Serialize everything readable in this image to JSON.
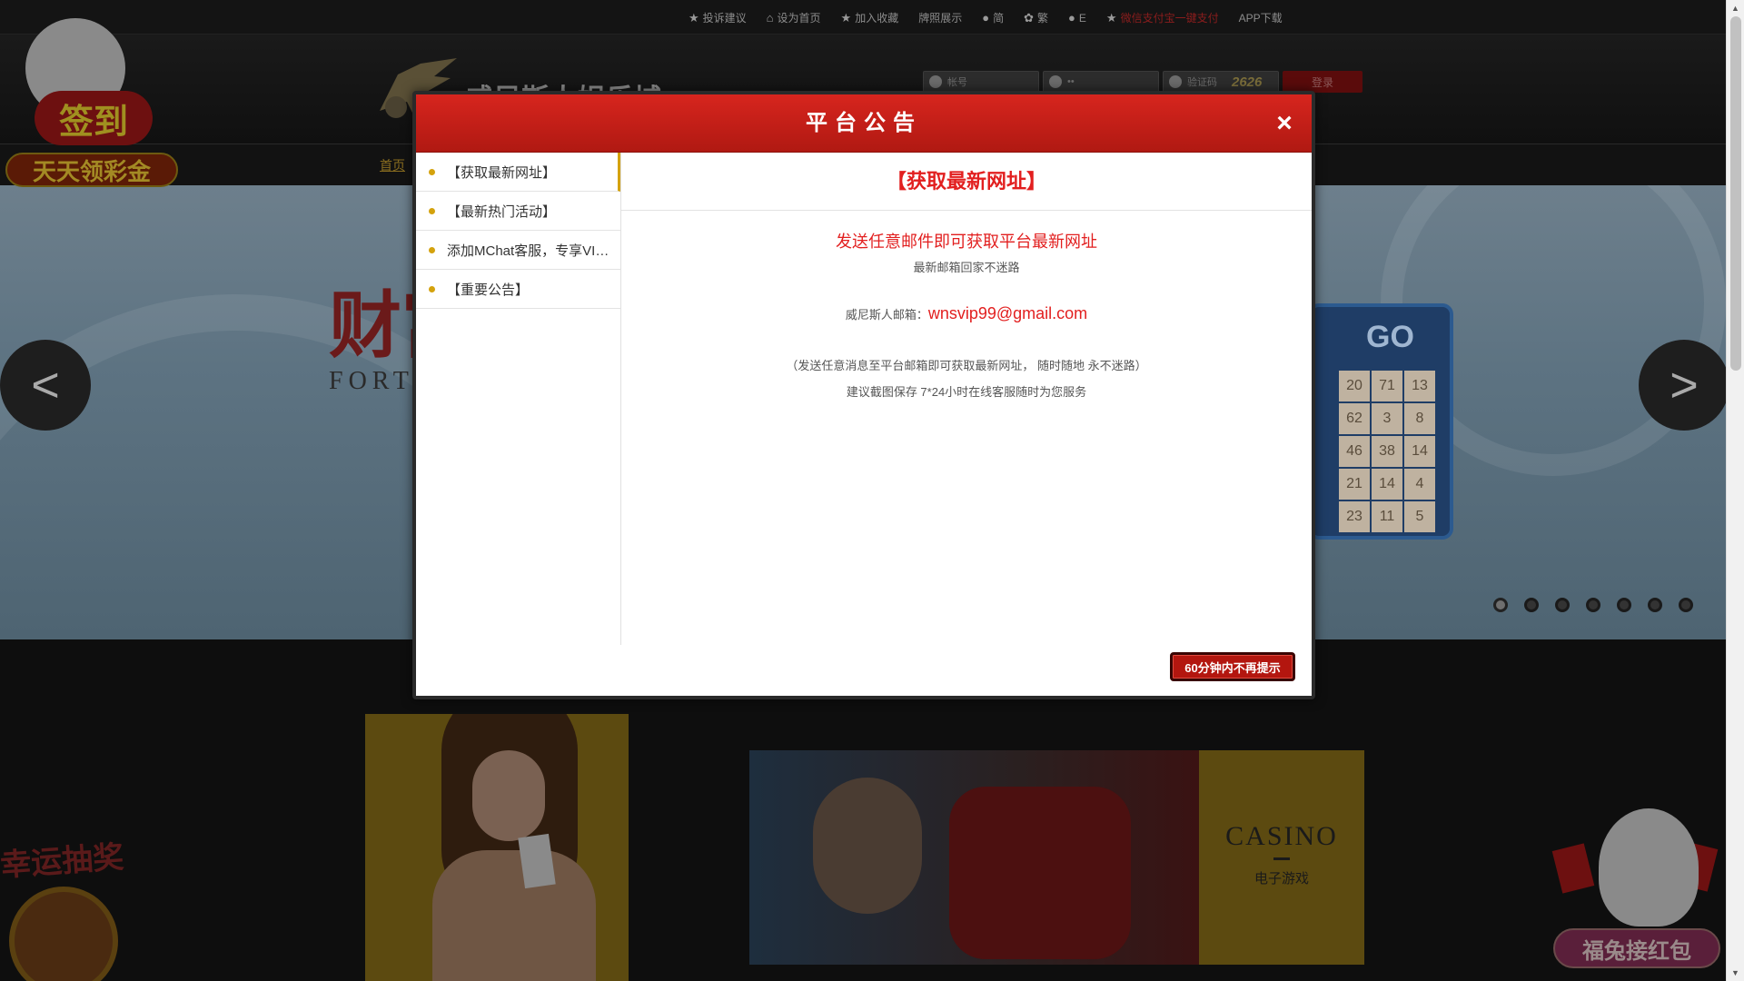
{
  "topbar": {
    "links": [
      {
        "icon": "star-icon",
        "label": "投诉建议"
      },
      {
        "icon": "home-icon",
        "label": "设为首页"
      },
      {
        "icon": "star-icon",
        "label": "加入收藏"
      },
      {
        "icon": "",
        "label": "牌照展示"
      },
      {
        "icon": "flag-cn-icon",
        "label": "简"
      },
      {
        "icon": "flag-hk-icon",
        "label": "繁"
      },
      {
        "icon": "flag-us-icon",
        "label": "E"
      },
      {
        "icon": "star-icon",
        "label": "微信支付宝一键支付"
      },
      {
        "icon": "",
        "label": "APP下载"
      }
    ]
  },
  "header": {
    "logo_text": "威尼斯人娱乐城",
    "login": {
      "account_placeholder": "帐号",
      "password_placeholder": "••",
      "captcha_placeholder": "验证码",
      "captcha_value": "2626",
      "login_label": "登录"
    }
  },
  "nav": {
    "home_label": "首页"
  },
  "banner": {
    "title_cn": "财富",
    "title_en": "FORT",
    "bingo_label": "GO",
    "numbers": [
      "20",
      "71",
      "13",
      "62",
      "3",
      "8",
      "46",
      "38",
      "14",
      "21",
      "14",
      "4",
      "23",
      "11",
      "5"
    ],
    "prev_label": "<",
    "next_label": ">",
    "slide_count": 7,
    "active_slide": 1
  },
  "promos": {
    "checkin_title": "签到",
    "checkin_sub": "天天领彩金",
    "lucky_title": "幸运抽奖",
    "redpacket_title": "福兔接红包"
  },
  "casino_card": {
    "title": "CASINO",
    "subtitle": "电子游戏"
  },
  "modal": {
    "title": "平台公告",
    "close_label": "×",
    "menu_items": [
      {
        "label": "【获取最新网址】",
        "active": true
      },
      {
        "label": "【最新热门活动】",
        "active": false
      },
      {
        "label": "添加MChat客服，专享VIP…",
        "active": false
      },
      {
        "label": "【重要公告】",
        "active": false
      }
    ],
    "content": {
      "title": "【获取最新网址】",
      "line1": "发送任意邮件即可获取平台最新网址",
      "line2": "最新邮箱回家不迷路",
      "email_prefix": "威尼斯人邮箱：",
      "email": "wnsvip99@gmail.com",
      "line4": "（发送任意消息至平台邮箱即可获取最新网址， 随时随地  永不迷路）",
      "line5": "建议截图保存 7*24小时在线客服随时为您服务"
    },
    "dismiss_label": "60分钟内不再提示"
  },
  "colors": {
    "modal_header": "#c81e17",
    "accent_red": "#e21f1f",
    "menu_dot": "#d4a20d"
  }
}
